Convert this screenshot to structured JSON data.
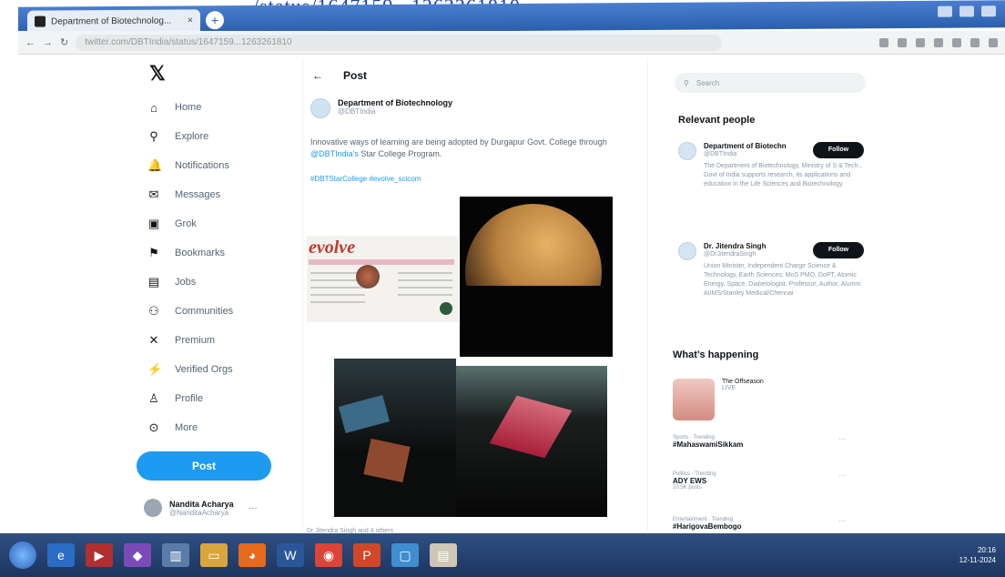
{
  "printed_url": "…/status/1647159...1263261810",
  "browser": {
    "tab_title": "Department of Biotechnolog...",
    "tab_close": "×",
    "new_tab": "+",
    "url": "twitter.com/DBTIndia/status/1647159...1263261810",
    "nav": {
      "back": "←",
      "forward": "→",
      "reload": "↻"
    }
  },
  "sidebar": {
    "logo": "𝕏",
    "items": [
      {
        "icon": "⌂",
        "label": "Home"
      },
      {
        "icon": "⚲",
        "label": "Explore"
      },
      {
        "icon": "🔔",
        "label": "Notifications"
      },
      {
        "icon": "✉",
        "label": "Messages"
      },
      {
        "icon": "▣",
        "label": "Grok"
      },
      {
        "icon": "⚑",
        "label": "Bookmarks"
      },
      {
        "icon": "▤",
        "label": "Jobs"
      },
      {
        "icon": "⚇",
        "label": "Communities"
      },
      {
        "icon": "✕",
        "label": "Premium"
      },
      {
        "icon": "⚡",
        "label": "Verified Orgs"
      },
      {
        "icon": "♙",
        "label": "Profile"
      },
      {
        "icon": "⊙",
        "label": "More"
      }
    ],
    "post_button": "Post",
    "account": {
      "name": "Nandita Acharya",
      "handle": "@NanditaAcharya",
      "more": "···"
    }
  },
  "main": {
    "back_arrow": "←",
    "header": "Post",
    "author": {
      "name": "Department of Biotechnology",
      "handle": "@DBTIndia"
    },
    "text_before": "Innovative ways of learning are being adopted by Durgapur Govt. College through ",
    "mention": "@DBTIndia's",
    "text_after": " Star College Program.",
    "link": "#DBTStarCollege #evolve_scicom",
    "image_text": "evolve",
    "media_caption": "Dr Jitendra Singh and 4 others"
  },
  "right": {
    "search_placeholder": "Search",
    "search_icon": "⚲",
    "relevant_title": "Relevant people",
    "people": [
      {
        "name": "Department of Biotechn",
        "handle": "@DBTIndia",
        "bio": "The Department of Biotechnology, Ministry of S & Tech., Govt of India supports research, its applications and education in the Life Sciences and Biotechnology.",
        "follow": "Follow"
      },
      {
        "name": "Dr. Jitendra Singh",
        "handle": "@DrJitendraSingh",
        "bio": "Union Minister, Independent Charge Science & Technology, Earth Sciences; MoS PMO, DoPT, Atomic Energy, Space. Diabetologist, Professor, Author, Alumni: AIIMS/Stanley Medical/Chennai",
        "follow": "Follow"
      }
    ],
    "whats_title": "What’s happening",
    "happening": {
      "title": "The Offseason",
      "sub": "LIVE"
    },
    "trends": [
      {
        "ctx": "Sports · Trending",
        "tag": "#MahaswamiSikkam",
        "cnt": "",
        "dots": "···"
      },
      {
        "ctx": "Politics · Trending",
        "tag": "ADY EWS",
        "cnt": "10.5K posts",
        "dots": "···"
      },
      {
        "ctx": "Entertainment · Trending",
        "tag": "#HarigovaBembogo",
        "cnt": "",
        "dots": "···"
      }
    ]
  },
  "taskbar": {
    "apps": [
      {
        "name": "start",
        "color": "#3a7bd5"
      },
      {
        "name": "ie-icon",
        "glyph": "e",
        "color": "#2b6cc4"
      },
      {
        "name": "media-icon",
        "glyph": "▶",
        "color": "#b03030"
      },
      {
        "name": "vs-icon",
        "glyph": "◆",
        "color": "#7a4bb8"
      },
      {
        "name": "files-icon",
        "glyph": "▥",
        "color": "#5a7ca8"
      },
      {
        "name": "folder-icon",
        "glyph": "▭",
        "color": "#d9a53c"
      },
      {
        "name": "firefox-icon",
        "glyph": "◕",
        "color": "#e66a1a"
      },
      {
        "name": "word-icon",
        "glyph": "W",
        "color": "#2b579a"
      },
      {
        "name": "chrome-icon",
        "glyph": "◉",
        "color": "#db4437"
      },
      {
        "name": "ppt-icon",
        "glyph": "P",
        "color": "#d24726"
      },
      {
        "name": "desktop-icon",
        "glyph": "▢",
        "color": "#3e8ed0"
      },
      {
        "name": "notes-icon",
        "glyph": "▤",
        "color": "#cfc7b3"
      }
    ],
    "clock_time": "20:16",
    "clock_date": "12-11-2024"
  },
  "colors": {
    "accent": "#1d9bf0",
    "follow_bg": "#0f1419",
    "taskbar": "#1d3561"
  }
}
